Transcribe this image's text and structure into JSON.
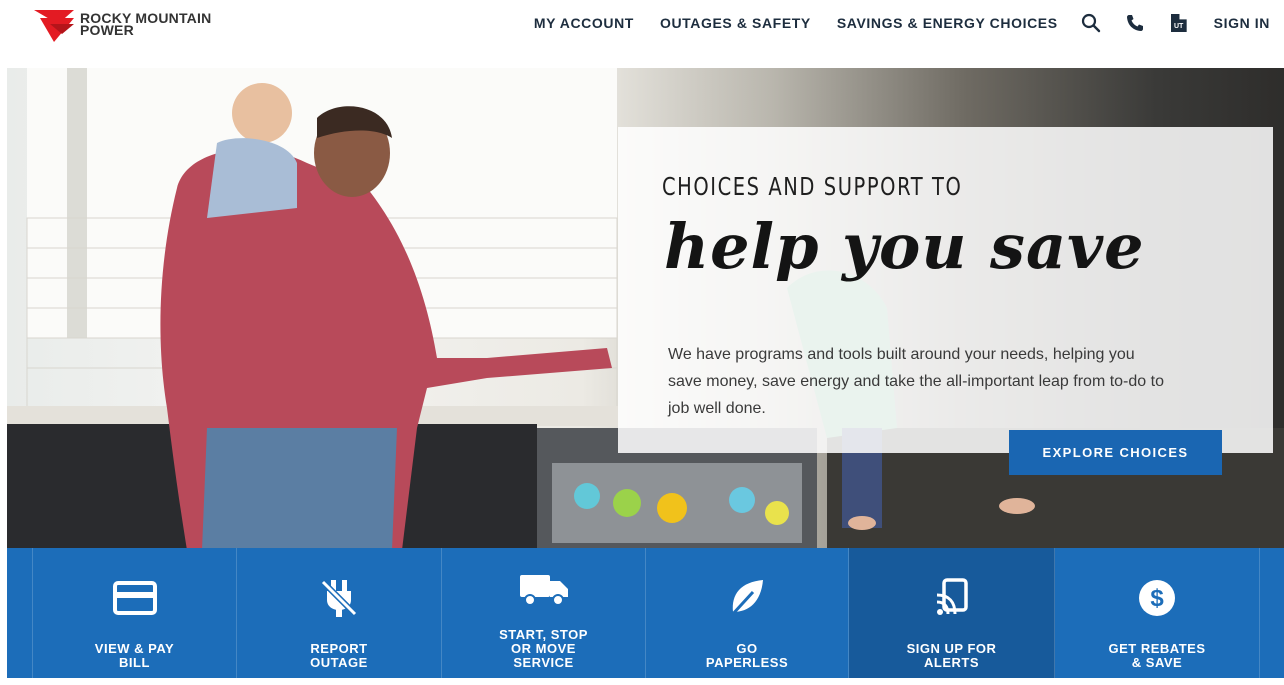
{
  "brand": {
    "name_line1": "ROCKY MOUNTAIN",
    "name_line2": "POWER",
    "colors": {
      "primary_blue": "#1c6db9",
      "cta_blue": "#1a66b2",
      "logo_red": "#e31b23"
    }
  },
  "nav": {
    "links": [
      "MY ACCOUNT",
      "OUTAGES & SAFETY",
      "SAVINGS & ENERGY CHOICES"
    ],
    "icons": [
      "search-icon",
      "phone-icon",
      "state-utah-icon"
    ],
    "state_abbr": "UT",
    "sign_in": "SIGN IN"
  },
  "hero": {
    "eyebrow": "CHOICES AND SUPPORT TO",
    "title": "help you save",
    "body": "We have programs and tools built around your needs, helping you save money, save energy and take the all-important leap from to-do to job well done.",
    "cta": "EXPLORE CHOICES"
  },
  "quick_links": [
    {
      "label": "VIEW & PAY\nBILL",
      "icon": "credit-card-icon"
    },
    {
      "label": "REPORT\nOUTAGE",
      "icon": "unplugged-icon"
    },
    {
      "label": "START, STOP\nOR MOVE\nSERVICE",
      "icon": "truck-icon"
    },
    {
      "label": "GO\nPAPERLESS",
      "icon": "leaf-icon"
    },
    {
      "label": "SIGN UP FOR\nALERTS",
      "icon": "mobile-alert-icon"
    },
    {
      "label": "GET REBATES\n& SAVE",
      "icon": "dollar-icon"
    }
  ]
}
